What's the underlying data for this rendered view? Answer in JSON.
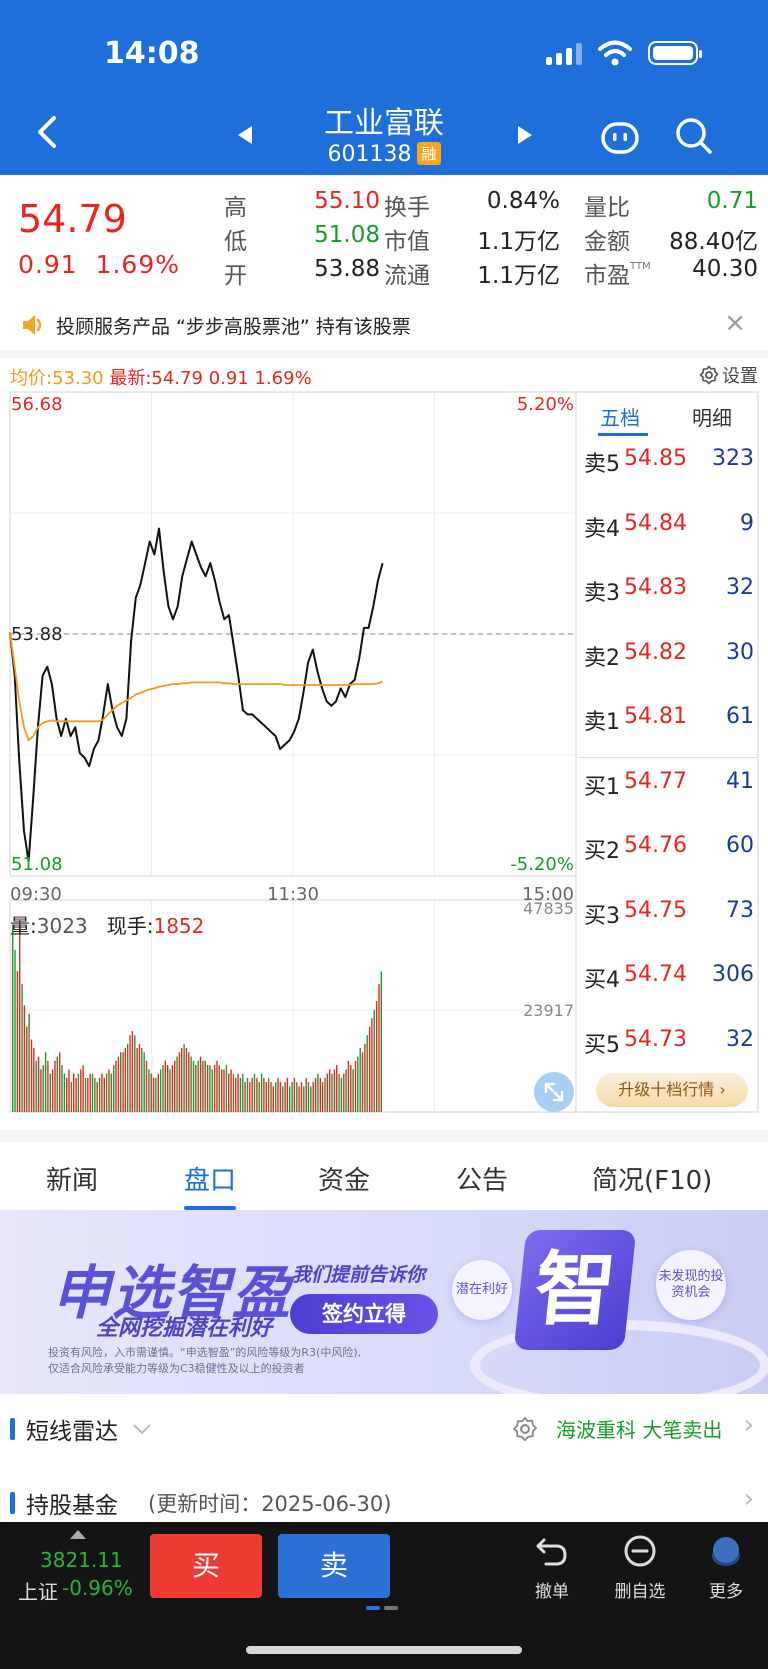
{
  "status_bar": {
    "time": "14:08"
  },
  "header": {
    "name": "工业富联",
    "code": "601138",
    "badge": "融"
  },
  "quote": {
    "price": "54.79",
    "change": "0.91",
    "change_pct": "1.69%",
    "stats": [
      {
        "label": "高",
        "value": "55.10",
        "color": "red"
      },
      {
        "label": "换手",
        "value": "0.84%",
        "color": "dark"
      },
      {
        "label": "量比",
        "value": "0.71",
        "color": "green"
      },
      {
        "label": "低",
        "value": "51.08",
        "color": "green"
      },
      {
        "label": "市值",
        "value": "1.1万亿",
        "color": "dark"
      },
      {
        "label": "金额",
        "value": "88.40亿",
        "color": "dark"
      },
      {
        "label": "开",
        "value": "53.88",
        "color": "dark"
      },
      {
        "label": "流通",
        "value": "1.1万亿",
        "color": "dark"
      },
      {
        "label": "市盈",
        "value": "40.30",
        "color": "dark",
        "sup": "TTM"
      }
    ]
  },
  "notice": {
    "text": "投顾服务产品 “步步高股票池” 持有该股票"
  },
  "chart_info": {
    "avg_label": "均价:53.30",
    "latest_label": "最新:54.79",
    "latest_change": "0.91",
    "latest_pct": "1.69%",
    "settings_label": "设置"
  },
  "chart_data": {
    "type": "line",
    "title": "",
    "x_ticks": [
      "09:30",
      "11:30",
      "15:00"
    ],
    "y_max": 56.68,
    "y_min": 51.08,
    "y_ref": 53.88,
    "y_max_label": "56.68",
    "y_min_label": "51.08",
    "y_ref_label": "53.88",
    "pct_max_label": "5.20%",
    "pct_min_label": "-5.20%",
    "total_minutes": 240,
    "elapsed_minutes": 158,
    "series": [
      {
        "values": [
          53.9,
          53.4,
          52.4,
          51.6,
          51.25,
          52.0,
          52.8,
          53.4,
          53.5,
          53.3,
          52.9,
          52.7,
          52.9,
          52.7,
          52.8,
          52.5,
          52.45,
          52.35,
          52.55,
          52.65,
          52.95,
          53.3,
          53.0,
          52.8,
          52.7,
          52.9,
          53.8,
          54.3,
          54.45,
          54.7,
          54.95,
          54.8,
          55.1,
          54.6,
          54.2,
          54.05,
          54.2,
          54.55,
          54.75,
          54.95,
          54.8,
          54.65,
          54.55,
          54.7,
          54.5,
          54.25,
          54.05,
          54.1,
          53.75,
          53.4,
          53.0,
          52.95,
          52.95,
          52.9,
          52.85,
          52.8,
          52.75,
          52.7,
          52.55,
          52.6,
          52.65,
          52.75,
          52.9,
          53.2,
          53.55,
          53.7,
          53.45,
          53.25,
          53.1,
          53.05,
          53.1,
          53.25,
          53.15,
          53.3,
          53.35,
          53.6,
          53.95,
          53.95,
          54.2,
          54.5,
          54.7
        ],
        "color": "#111111"
      },
      {
        "values": [
          53.9,
          53.5,
          53.1,
          52.8,
          52.65,
          52.7,
          52.8,
          52.85,
          52.87,
          52.88,
          52.87,
          52.87,
          52.87,
          52.87,
          52.87,
          52.87,
          52.87,
          52.87,
          52.87,
          52.87,
          52.89,
          52.95,
          53.0,
          53.05,
          53.08,
          53.11,
          53.14,
          53.18,
          53.2,
          53.22,
          53.24,
          53.25,
          53.27,
          53.28,
          53.29,
          53.3,
          53.3,
          53.31,
          53.31,
          53.32,
          53.32,
          53.32,
          53.32,
          53.32,
          53.32,
          53.32,
          53.31,
          53.31,
          53.3,
          53.3,
          53.3,
          53.3,
          53.3,
          53.3,
          53.3,
          53.3,
          53.3,
          53.3,
          53.3,
          53.29,
          53.29,
          53.29,
          53.29,
          53.29,
          53.29,
          53.29,
          53.29,
          53.29,
          53.29,
          53.29,
          53.29,
          53.29,
          53.29,
          53.29,
          53.3,
          53.3,
          53.3,
          53.3,
          53.3,
          53.31,
          53.33
        ],
        "color": "#f29b1f"
      }
    ],
    "volume": {
      "label": "量:",
      "value": "3023",
      "current_label": "现手:",
      "current_value": "1852",
      "max_label": "47835",
      "mid_label": "23917",
      "max": 47835,
      "values": [
        44000,
        38000,
        33000,
        45000,
        30000,
        25000,
        20000,
        23000,
        17000,
        15000,
        12000,
        13000,
        10000,
        11000,
        14000,
        12000,
        9000,
        10000,
        12000,
        13000,
        14000,
        11000,
        9000,
        8000,
        10000,
        7000,
        9000,
        8000,
        9000,
        10000,
        11000,
        8000,
        8000,
        9000,
        9000,
        8000,
        7000,
        8000,
        9000,
        8000,
        9000,
        10000,
        9000,
        11000,
        12000,
        13000,
        14000,
        14000,
        15000,
        16000,
        18000,
        19000,
        18000,
        15000,
        16000,
        15000,
        14000,
        12000,
        10000,
        9000,
        8000,
        8000,
        9000,
        10000,
        11000,
        12000,
        11000,
        10000,
        11000,
        12000,
        13000,
        14000,
        15000,
        16000,
        15000,
        14000,
        13000,
        12000,
        11000,
        12000,
        13000,
        12000,
        12000,
        11000,
        11000,
        10000,
        11000,
        12000,
        11000,
        10000,
        10000,
        11000,
        9000,
        10000,
        9000,
        8000,
        9000,
        8000,
        9000,
        7000,
        8000,
        7000,
        8000,
        9000,
        8000,
        7000,
        9000,
        8000,
        7000,
        8000,
        7000,
        6000,
        7000,
        8000,
        7000,
        6000,
        7000,
        8000,
        6000,
        7000,
        8000,
        7000,
        6000,
        7000,
        6000,
        8000,
        7000,
        6000,
        7000,
        8000,
        9000,
        8000,
        7000,
        8000,
        9000,
        10000,
        9000,
        10000,
        11000,
        9000,
        8000,
        9000,
        10000,
        12000,
        11000,
        10000,
        12000,
        13000,
        15000,
        14000,
        16000,
        18000,
        20000,
        22000,
        24000,
        26000,
        30000,
        33000
      ],
      "colors_pattern": "mixed"
    }
  },
  "order_book": {
    "tab_five": "五档",
    "tab_detail": "明细",
    "asks": [
      {
        "label": "卖5",
        "price": "54.85",
        "vol": "323"
      },
      {
        "label": "卖4",
        "price": "54.84",
        "vol": "9"
      },
      {
        "label": "卖3",
        "price": "54.83",
        "vol": "32"
      },
      {
        "label": "卖2",
        "price": "54.82",
        "vol": "30"
      },
      {
        "label": "卖1",
        "price": "54.81",
        "vol": "61"
      }
    ],
    "bids": [
      {
        "label": "买1",
        "price": "54.77",
        "vol": "41"
      },
      {
        "label": "买2",
        "price": "54.76",
        "vol": "60"
      },
      {
        "label": "买3",
        "price": "54.75",
        "vol": "73"
      },
      {
        "label": "买4",
        "price": "54.74",
        "vol": "306"
      },
      {
        "label": "买5",
        "price": "54.73",
        "vol": "32"
      }
    ],
    "upgrade": "升级十档行情 ›"
  },
  "tabs": [
    {
      "label": "新闻"
    },
    {
      "label": "盘口",
      "active": true
    },
    {
      "label": "资金"
    },
    {
      "label": "公告"
    },
    {
      "label": "简况(F10)"
    }
  ],
  "banner": {
    "title": "申选智盈",
    "subtitle": "全网挖掘潜在利好",
    "tell": "我们提前告诉你",
    "cta": "签约立得",
    "fine1": "投资有风险，入市需谨慎。“申选智盈”的风险等级为R3(中风险),",
    "fine2": "仅适合风险承受能力等级为C3稳健性及以上的投资者",
    "bubble1": "潜在利好",
    "bubble2": "未发现的投资机会",
    "big_char": "智"
  },
  "radar": {
    "title": "短线雷达",
    "hint": "海波重科 大笔卖出"
  },
  "fund": {
    "title": "持股基金",
    "sub": "(更新时间：2025-06-30)"
  },
  "bottom_bar": {
    "index_value": "3821.11",
    "index_name": "上证",
    "index_pct": "-0.96%",
    "buy": "买",
    "sell": "卖",
    "actions": [
      {
        "label": "撤单",
        "icon": "undo-icon"
      },
      {
        "label": "删自选",
        "icon": "remove-watchlist-icon"
      },
      {
        "label": "更多",
        "icon": "more-icon"
      }
    ]
  },
  "colors": {
    "brand": "#1e6fd9",
    "up": "#e8261f",
    "down": "#1a9a2b",
    "avg_line": "#f29b1f"
  }
}
